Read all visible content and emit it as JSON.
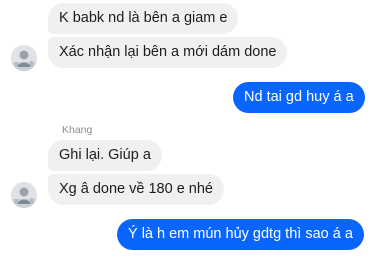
{
  "conversation": {
    "messages": [
      {
        "direction": "incoming",
        "text": "K babk nd là bên a giam e"
      },
      {
        "direction": "incoming",
        "text": "Xác nhận lại bên a mới dám done"
      },
      {
        "direction": "outgoing",
        "text": "Nd tai gd huy á a"
      },
      {
        "direction": "incoming",
        "sender": "Khang",
        "text": "Ghi lại. Giúp a"
      },
      {
        "direction": "incoming",
        "text": "Xg â done về 180 e nhé"
      },
      {
        "direction": "outgoing",
        "text": "Ý là h em mún hủy gdtg thì sao á a"
      }
    ]
  },
  "colors": {
    "incoming_bubble": "#f0f0f0",
    "outgoing_bubble": "#0866ff",
    "incoming_text": "#1c1c1c",
    "outgoing_text": "#ffffff",
    "sender_name": "#8a8d91"
  },
  "icons": {
    "avatar": "contact-avatar-icon"
  }
}
